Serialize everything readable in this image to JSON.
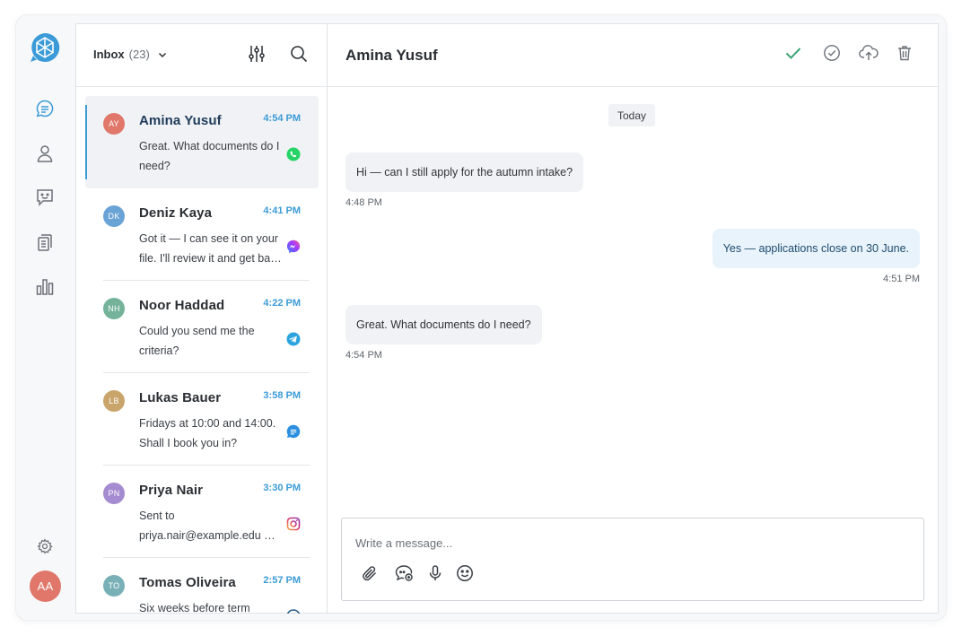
{
  "app": {
    "user_avatar_initials": "AA",
    "user_avatar_color": "#e0776a",
    "accent_color": "#3b9bd8"
  },
  "rail": {
    "items": [
      {
        "icon": "chat-icon",
        "active": true
      },
      {
        "icon": "contacts-icon",
        "active": false
      },
      {
        "icon": "feedback-icon",
        "active": false
      },
      {
        "icon": "templates-icon",
        "active": false
      },
      {
        "icon": "reports-icon",
        "active": false
      }
    ],
    "settings_icon": "gear-icon"
  },
  "inbox": {
    "title": "Inbox",
    "count": "(23)"
  },
  "conversations": [
    {
      "initials": "AY",
      "avatar_color": "#e0776a",
      "name": "Amina Yusuf",
      "time": "4:54 PM",
      "preview": "Great. What documents do I need?",
      "channel": "whatsapp-icon",
      "active": true
    },
    {
      "initials": "DK",
      "avatar_color": "#6aa3d6",
      "name": "Deniz Kaya",
      "time": "4:41 PM",
      "preview": "Got it — I can see it on your file. I'll review it and get back to you.",
      "channel": "messenger-icon",
      "active": false
    },
    {
      "initials": "NH",
      "avatar_color": "#74b39a",
      "name": "Noor Haddad",
      "time": "4:22 PM",
      "preview": "Could you send me the criteria?",
      "channel": "telegram-icon",
      "active": false
    },
    {
      "initials": "LB",
      "avatar_color": "#c9a56b",
      "name": "Lukas Bauer",
      "time": "3:58 PM",
      "preview": "Fridays at 10:00 and 14:00. Shall I book you in?",
      "channel": "livechat-icon",
      "active": false
    },
    {
      "initials": "PN",
      "avatar_color": "#a58bcf",
      "name": "Priya Nair",
      "time": "3:30 PM",
      "preview": "Sent to priya.nair@example.edu — check your inbox.",
      "channel": "instagram-icon",
      "active": false
    },
    {
      "initials": "TO",
      "avatar_color": "#79b0b8",
      "name": "Tomas Oliveira",
      "time": "2:57 PM",
      "preview": "Six weeks before term starts.",
      "channel": "email-icon",
      "active": false
    }
  ],
  "chat": {
    "contact_name": "Amina Yusuf",
    "day_label": "Today",
    "messages": [
      {
        "direction": "in",
        "text": "Hi — can I still apply for the autumn intake?",
        "time": "4:48 PM"
      },
      {
        "direction": "out",
        "text": "Yes — applications close on 30 June.",
        "time": "4:51 PM"
      },
      {
        "direction": "in",
        "text": "Great. What documents do I need?",
        "time": "4:54 PM"
      }
    ],
    "actions": [
      "check-icon",
      "resolve-circle-icon",
      "cloud-upload-icon",
      "trash-icon"
    ]
  },
  "composer": {
    "placeholder": "Write a message...",
    "value": "",
    "tools": [
      "attachment-icon",
      "quick-reply-icon",
      "microphone-icon",
      "emoji-icon"
    ]
  }
}
